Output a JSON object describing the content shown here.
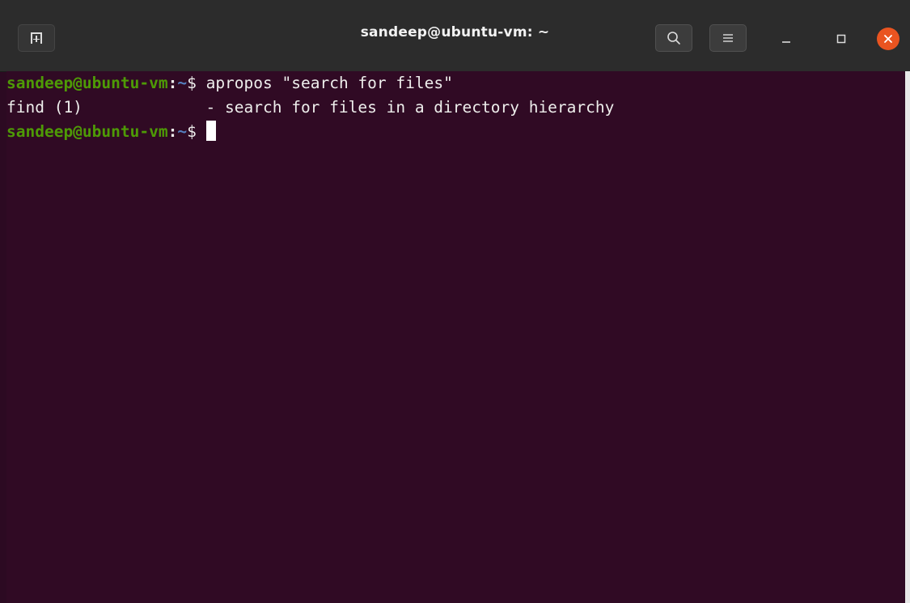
{
  "window": {
    "title": "sandeep@ubuntu-vm: ~"
  },
  "toolbar": {
    "new_tab_icon": "new-tab-icon",
    "search_icon": "search-icon",
    "menu_icon": "hamburger-menu-icon",
    "minimize_icon": "minimize-icon",
    "maximize_icon": "maximize-icon",
    "close_icon": "close-icon"
  },
  "terminal": {
    "lines": [
      {
        "prompt_user": "sandeep@ubuntu-vm",
        "prompt_colon": ":",
        "prompt_path": "~",
        "prompt_sign": "$ ",
        "command": "apropos \"search for files\""
      },
      {
        "output": "find (1)             - search for files in a directory hierarchy"
      },
      {
        "prompt_user": "sandeep@ubuntu-vm",
        "prompt_colon": ":",
        "prompt_path": "~",
        "prompt_sign": "$ ",
        "command": ""
      }
    ]
  },
  "colors": {
    "terminal_background": "#300a24",
    "prompt_user": "#4e9a06",
    "prompt_path": "#5580c0",
    "close_button": "#e95420",
    "titlebar": "#2c2c2c"
  }
}
